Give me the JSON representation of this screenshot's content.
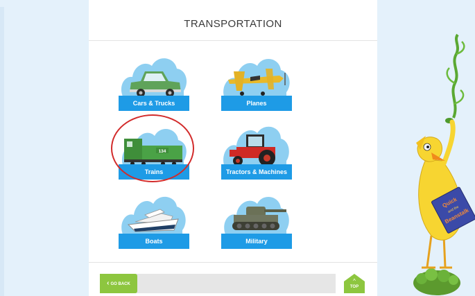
{
  "page": {
    "title": "TRANSPORTATION"
  },
  "categories": [
    {
      "label": "Cars & Trucks",
      "icon": "car-icon"
    },
    {
      "label": "Planes",
      "icon": "plane-icon"
    },
    {
      "label": "Trains",
      "icon": "train-icon",
      "engine_number": "134",
      "highlighted": true
    },
    {
      "label": "Tractors & Machines",
      "icon": "tractor-icon"
    },
    {
      "label": "Boats",
      "icon": "boat-icon"
    },
    {
      "label": "Military",
      "icon": "tank-icon"
    }
  ],
  "footer": {
    "go_back_label": "GO BACK",
    "top_label": "TOP"
  },
  "mascot": {
    "book_title_lines": [
      "Quick",
      "and the",
      "Beanstalk"
    ]
  },
  "colors": {
    "cloud": "#8ecff1",
    "label_bg": "#1e9be6",
    "side_bg": "#e4f1fb",
    "button_green": "#8dc63f",
    "highlight_red": "#d22b2b"
  }
}
